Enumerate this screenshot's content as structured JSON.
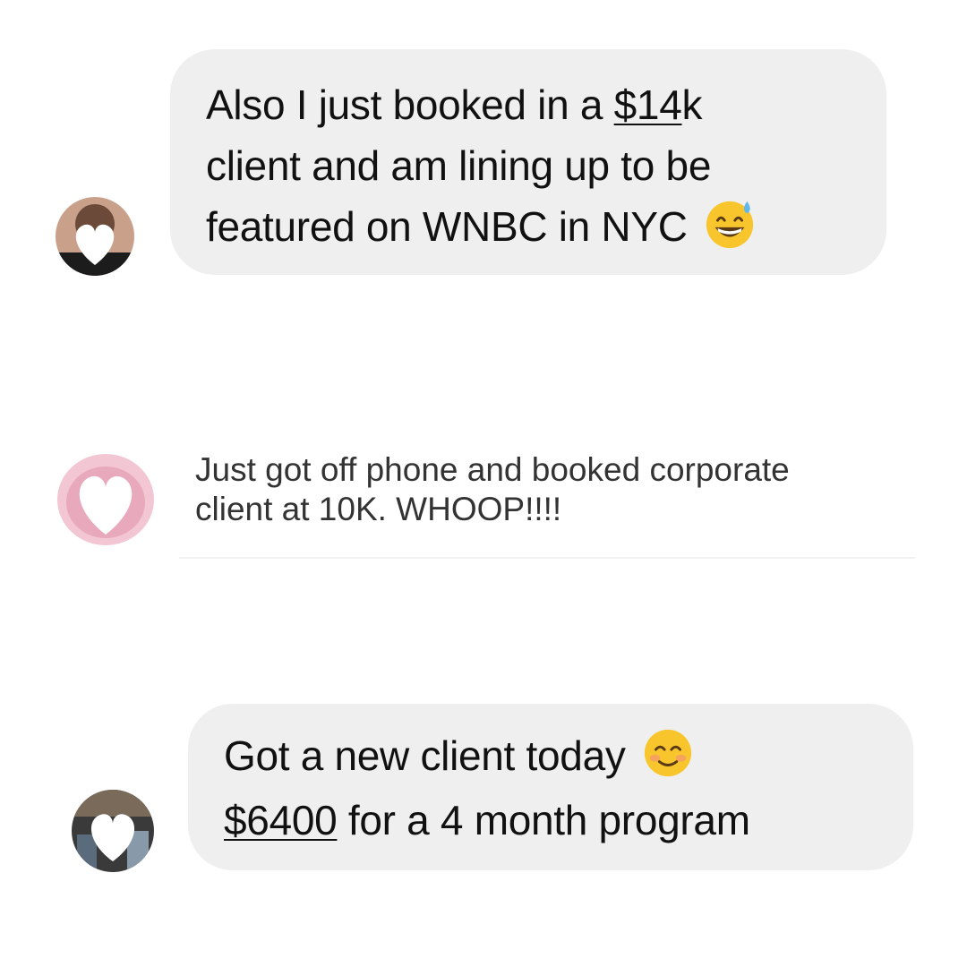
{
  "messages": [
    {
      "lines": [
        {
          "pre": "Also I just booked in a ",
          "link": "$14",
          "post": "k"
        },
        {
          "text": "client and am lining up to be"
        },
        {
          "text": "featured on WNBC in NYC"
        }
      ],
      "emoji": "grinning-sweat-emoji"
    },
    {
      "lines": [
        {
          "text": "Just got off phone and booked corporate"
        },
        {
          "text": "client at 10K. WHOOP!!!!"
        }
      ]
    },
    {
      "lines": [
        {
          "text": "Got a new client today"
        },
        {
          "link": "$6400",
          "post": " for a 4 month program"
        }
      ],
      "emoji": "smiling-blush-emoji"
    }
  ],
  "colors": {
    "bubble": "#efefef",
    "text": "#111111",
    "emoji_yellow": "#f8c52c",
    "censor_heart": "#ffffff"
  }
}
